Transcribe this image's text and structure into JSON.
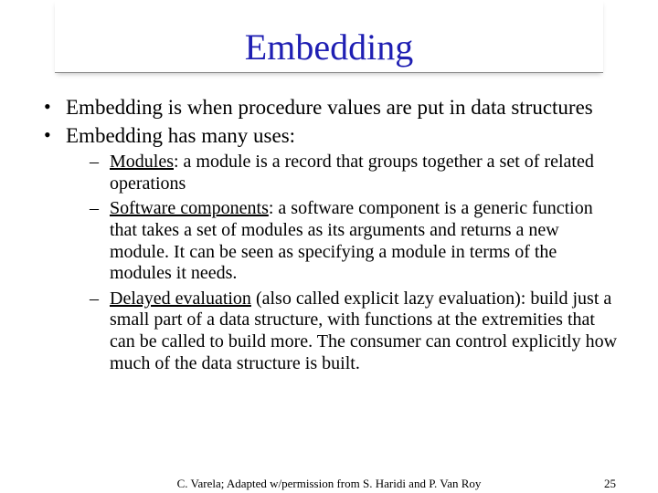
{
  "title": "Embedding",
  "bullets": {
    "b1": "Embedding is when procedure values are put in data structures",
    "b2": "Embedding has many uses:",
    "sub1_lead": "Modules",
    "sub1_rest": ": a module is a record that groups together a set of related operations",
    "sub2_lead": "Software components",
    "sub2_rest": ": a software component is a generic function that takes a set of modules as its arguments and returns a new module.  It can be seen as specifying a module in terms of the modules it needs.",
    "sub3_lead": "Delayed evaluation",
    "sub3_mid": " (also called explicit lazy evaluation): build just a small part of a data structure, with functions at the extremities that can be called to build more.  The consumer can control explicitly how much of the data structure is built."
  },
  "footer": {
    "credit": "C. Varela; Adapted w/permission from S. Haridi and P. Van Roy",
    "page": "25"
  }
}
